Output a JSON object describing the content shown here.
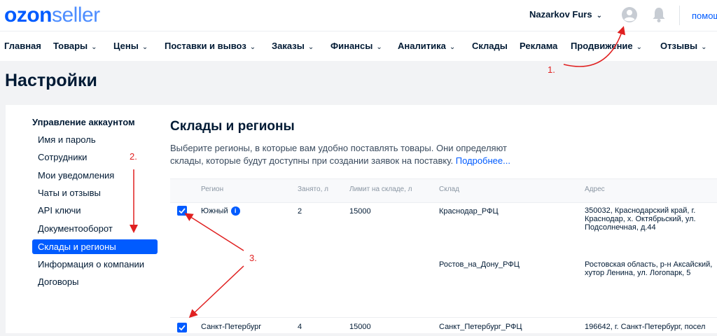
{
  "header": {
    "logo_ozon": "ozon",
    "logo_seller": "seller",
    "user_name": "Nazarkov Furs",
    "help_label": "помощь"
  },
  "nav": [
    {
      "label": "Главная",
      "dropdown": false
    },
    {
      "label": "Товары",
      "dropdown": true
    },
    {
      "label": "Цены",
      "dropdown": true
    },
    {
      "label": "Поставки и вывоз",
      "dropdown": true
    },
    {
      "label": "Заказы",
      "dropdown": true
    },
    {
      "label": "Финансы",
      "dropdown": true
    },
    {
      "label": "Аналитика",
      "dropdown": true
    },
    {
      "label": "Склады",
      "dropdown": false
    },
    {
      "label": "Реклама",
      "dropdown": false
    },
    {
      "label": "Продвижение",
      "dropdown": true
    },
    {
      "label": "Отзывы",
      "dropdown": true
    }
  ],
  "page_title": "Настройки",
  "sidebar": {
    "heading": "Управление аккаунтом",
    "items": [
      "Имя и пароль",
      "Сотрудники",
      "Мои уведомления",
      "Чаты и отзывы",
      "API ключи",
      "Документооборот",
      "Склады и регионы",
      "Информация о компании",
      "Договоры"
    ],
    "active_index": 6
  },
  "section": {
    "title": "Склады и регионы",
    "description": "Выберите регионы, в которые вам удобно поставлять товары. Они определяют склады, которые будут доступны при создании заявок на поставку.",
    "more_link": "Подробнее..."
  },
  "table": {
    "headers": [
      "Регион",
      "Занято, л",
      "Лимит на складе, л",
      "Склад",
      "Адрес"
    ],
    "rows": [
      {
        "region": "Южный",
        "occupied": "2",
        "limit": "15000",
        "warehouse": "Краснодар_РФЦ",
        "address": "350032, Краснодарский край, г. Краснодар, х. Октябрьский, ул. Подсолнечная, д.44",
        "checked": true,
        "info": true
      },
      {
        "region": "",
        "occupied": "",
        "limit": "",
        "warehouse": "Ростов_на_Дону_РФЦ",
        "address": "Ростовская область, р-н Аксайский, хутор Ленина, ул. Логопарк, 5",
        "checked": false,
        "info": false
      },
      {
        "region": "Санкт-Петербург",
        "occupied": "4",
        "limit": "15000",
        "warehouse": "Санкт_Петербург_РФЦ",
        "address": "196642, г. Санкт-Петербург, посел",
        "checked": true,
        "info": false
      }
    ]
  },
  "annotations": {
    "one": "1.",
    "two": "2.",
    "three": "3."
  },
  "colors": {
    "brand": "#005bff",
    "annotation": "#e02020"
  }
}
